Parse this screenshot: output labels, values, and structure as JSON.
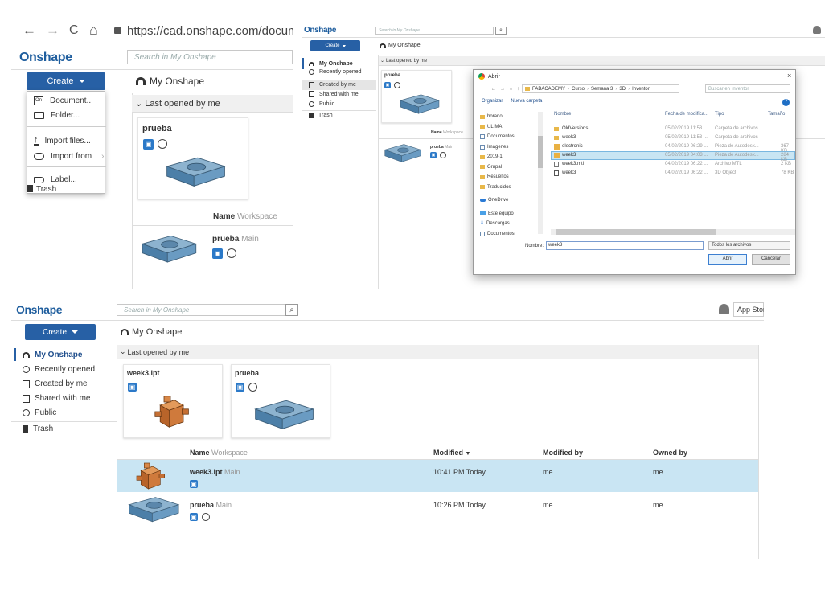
{
  "p1": {
    "nav_back": "←",
    "nav_forward": "→",
    "nav_reload": "C",
    "nav_home": "⌂",
    "url": "https://cad.onshape.com/documents?n",
    "logo": "Onshape",
    "search_placeholder": "Search in My Onshape",
    "create_label": "Create",
    "crumb": "My Onshape",
    "last_opened": "Last opened by me",
    "menu": {
      "document": "Document...",
      "folder": "Folder...",
      "import_files": "Import files...",
      "import_from": "Import from",
      "label": "Label..."
    },
    "sidebar_trash": "Trash",
    "card_title": "prueba",
    "col_name": "Name",
    "col_workspace": "Workspace",
    "row_name": "prueba",
    "row_branch": "Main"
  },
  "p2": {
    "logo": "Onshape",
    "search_placeholder": "Search in My Onshape",
    "create_label": "Create",
    "crumb": "My Onshape",
    "nav": [
      "My Onshape",
      "Recently opened",
      "Created by me",
      "Shared with me",
      "Public",
      "Trash"
    ],
    "last_opened": "Last opened by me",
    "card_title": "prueba",
    "col_name": "Name",
    "col_workspace": "Workspace",
    "row_name": "prueba",
    "row_branch": "Main",
    "dialog": {
      "title": "Abrir",
      "path": [
        "FABACADEMY",
        "Curso",
        "Semana 3",
        "3D",
        "Inventor"
      ],
      "search_placeholder": "Buscar en Inventor",
      "organize": "Organizar",
      "new_folder": "Nueva carpeta",
      "tree": [
        "horario",
        "ULIMA",
        "Documentos",
        "Imagenes",
        "2019-1",
        "Grupal",
        "Resueltos",
        "Traducidos",
        "OneDrive",
        "Este equipo",
        "Descargas",
        "Documentos"
      ],
      "headers": [
        "Nombre",
        "Fecha de modifica...",
        "Tipo",
        "Tamaño"
      ],
      "files": [
        {
          "name": "OldVersions",
          "date": "05/02/2019 11:53 ...",
          "type": "Carpeta de archivos",
          "size": ""
        },
        {
          "name": "week3",
          "date": "05/02/2019 11:53 ...",
          "type": "Carpeta de archivos",
          "size": ""
        },
        {
          "name": "electronic",
          "date": "04/02/2019 06:29 ...",
          "type": "Pieza de Autodesk...",
          "size": "367 KB"
        },
        {
          "name": "week3",
          "date": "05/02/2019 04:03 ...",
          "type": "Pieza de Autodesk...",
          "size": "284 KB"
        },
        {
          "name": "week3.mtl",
          "date": "04/02/2019 06:22 ...",
          "type": "Archivo MTL",
          "size": "2 KB"
        },
        {
          "name": "week3",
          "date": "04/02/2019 06:22 ...",
          "type": "3D Object",
          "size": "78 KB"
        }
      ],
      "filename_label": "Nombre:",
      "filename_value": "week3",
      "filter": "Todos los archivos",
      "open_btn": "Abrir",
      "cancel_btn": "Cancelar"
    }
  },
  "p3": {
    "logo": "Onshape",
    "search_placeholder": "Search in My Onshape",
    "app_store": "App Store",
    "create_label": "Create",
    "crumb": "My Onshape",
    "nav": [
      "My Onshape",
      "Recently opened",
      "Created by me",
      "Shared with me",
      "Public",
      "Trash"
    ],
    "last_opened": "Last opened by me",
    "cards": [
      "week3.ipt",
      "prueba"
    ],
    "headers": {
      "name": "Name",
      "workspace": "Workspace",
      "modified": "Modified",
      "modified_by": "Modified by",
      "owned_by": "Owned by"
    },
    "rows": [
      {
        "name": "week3.ipt",
        "branch": "Main",
        "modified": "10:41 PM Today",
        "modified_by": "me",
        "owned_by": "me"
      },
      {
        "name": "prueba",
        "branch": "Main",
        "modified": "10:26 PM Today",
        "modified_by": "me",
        "owned_by": "me"
      }
    ]
  },
  "colors": {
    "brand": "#1f5e9e",
    "create": "#2760a5",
    "selected_row": "#c9e5f3"
  }
}
